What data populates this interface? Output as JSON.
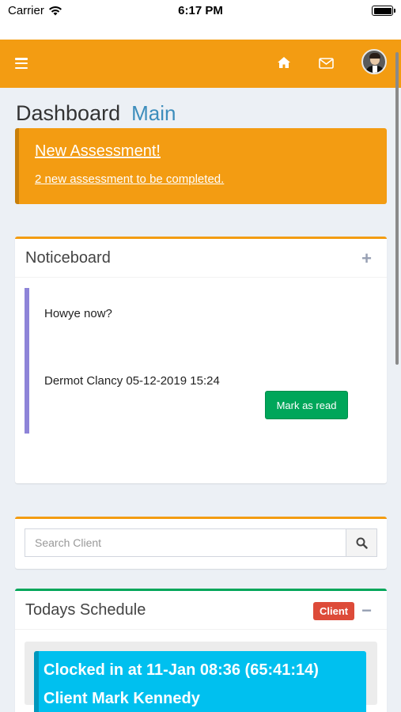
{
  "status_bar": {
    "carrier": "Carrier",
    "time": "6:17 PM"
  },
  "navbar": {
    "menu_icon": "hamburger-icon",
    "home_icon": "home-icon",
    "mail_icon": "envelope-icon",
    "avatar": "user-avatar",
    "accent_color": "#f39c12"
  },
  "page": {
    "title": "Dashboard",
    "subtitle": "Main"
  },
  "callout": {
    "title": "New Assessment!",
    "message": "2 new assessment to be completed."
  },
  "noticeboard": {
    "title": "Noticeboard",
    "add_icon": "plus-icon",
    "notice": {
      "text": "Howye now?",
      "author_line": "Dermot Clancy 05-12-2019 15:24",
      "button_label": "Mark as read"
    }
  },
  "search": {
    "placeholder": "Search Client",
    "icon": "search-icon"
  },
  "schedule": {
    "title": "Todays Schedule",
    "badge": "Client",
    "collapse_icon": "minus-icon",
    "clocked_line": "Clocked in at 11-Jan 08:36 (65:41:14)",
    "client_line": "Client Mark Kennedy"
  }
}
